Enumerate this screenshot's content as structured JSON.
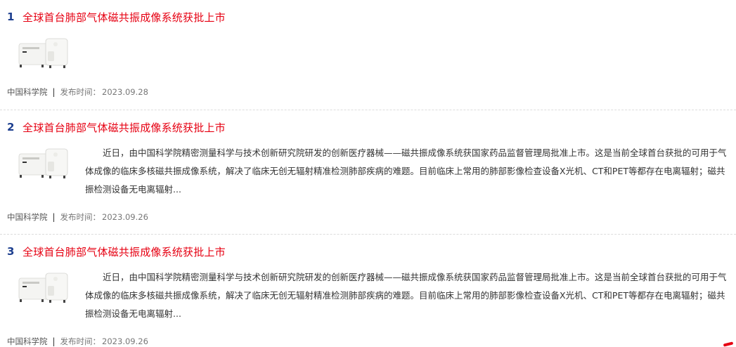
{
  "items": [
    {
      "num": "1",
      "title": "全球首台肺部气体磁共振成像系统获批上市",
      "summary": "",
      "source": "中国科学院",
      "date_label": "发布时间：",
      "date": "2023.09.28"
    },
    {
      "num": "2",
      "title": "全球首台肺部气体磁共振成像系统获批上市",
      "summary": "近日，由中国科学院精密测量科学与技术创新研究院研发的创新医疗器械——磁共振成像系统获国家药品监督管理局批准上市。这是当前全球首台获批的可用于气体成像的临床多核磁共振成像系统，解决了临床无创无辐射精准检测肺部疾病的难题。目前临床上常用的肺部影像检查设备X光机、CT和PET等都存在电离辐射；磁共振检测设备无电离辐射...",
      "source": "中国科学院",
      "date_label": "发布时间：",
      "date": "2023.09.26"
    },
    {
      "num": "3",
      "title": "全球首台肺部气体磁共振成像系统获批上市",
      "summary": "近日，由中国科学院精密测量科学与技术创新研究院研发的创新医疗器械——磁共振成像系统获国家药品监督管理局批准上市。这是当前全球首台获批的可用于气体成像的临床多核磁共振成像系统，解决了临床无创无辐射精准检测肺部疾病的难题。目前临床上常用的肺部影像检查设备X光机、CT和PET等都存在电离辐射；磁共振检测设备无电离辐射...",
      "source": "中国科学院",
      "date_label": "发布时间：",
      "date": "2023.09.26"
    }
  ],
  "colors": {
    "title": "#e60012",
    "number": "#1d3f8f",
    "text": "#333333",
    "meta": "#777777"
  }
}
